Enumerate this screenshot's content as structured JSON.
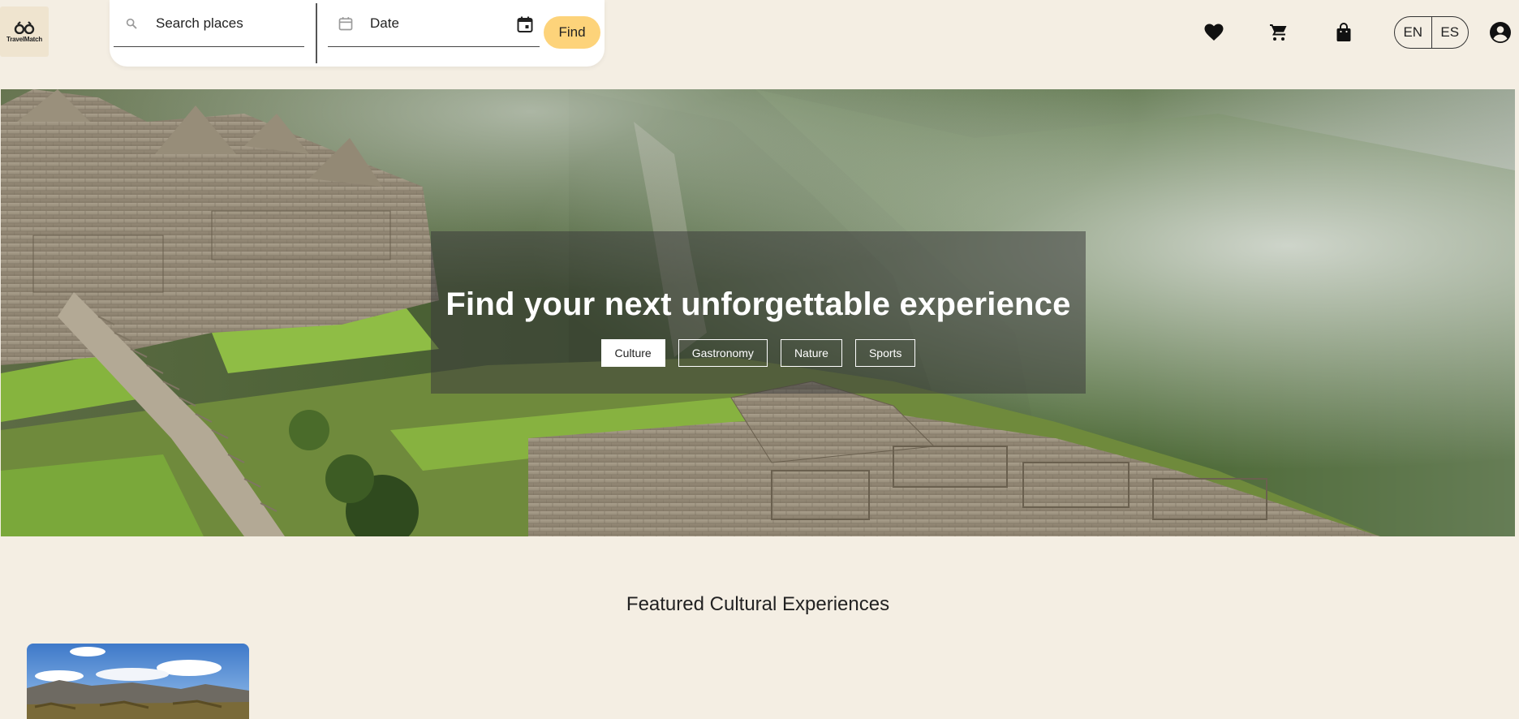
{
  "brand": {
    "logo_text": "TravelMatch"
  },
  "search": {
    "places_placeholder": "Search places",
    "date_placeholder": "Date",
    "find_label": "Find"
  },
  "header": {
    "icons": [
      "heart-icon",
      "cart-icon",
      "shopping-bag-icon",
      "account-icon"
    ],
    "languages": [
      "EN",
      "ES"
    ]
  },
  "hero": {
    "title": "Find your next unforgettable experience",
    "categories": [
      "Culture",
      "Gastronomy",
      "Nature",
      "Sports"
    ],
    "active_category": "Culture"
  },
  "featured": {
    "title": "Featured Cultural Experiences"
  },
  "colors": {
    "background": "#f4eee3",
    "accent_button": "#fdd37a",
    "card_white": "#ffffff"
  }
}
